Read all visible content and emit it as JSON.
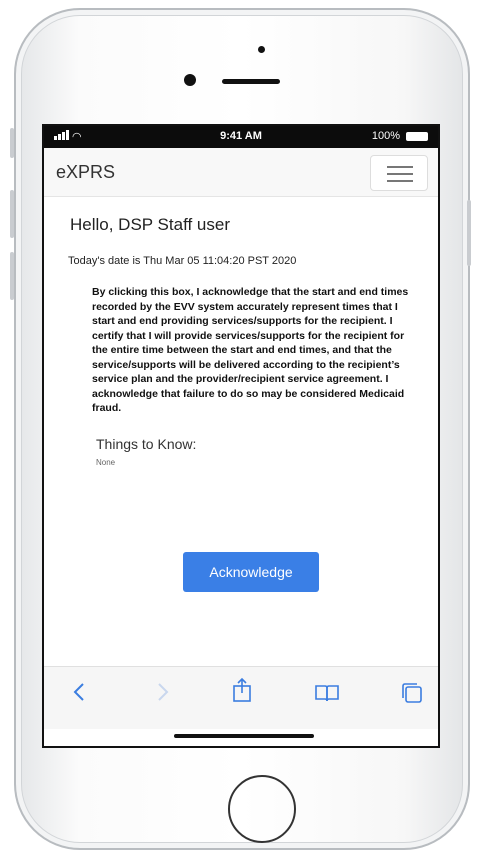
{
  "status_bar": {
    "time": "9:41 AM",
    "battery": "100%"
  },
  "navbar": {
    "brand": "eXPRS"
  },
  "main": {
    "greeting": "Hello, DSP Staff user",
    "date_line": "Today's date is Thu Mar 05 11:04:20 PST 2020",
    "acknowledgement_text": "By clicking this box, I acknowledge that the start and end times recorded by the EVV system accurately represent times that I start and end providing services/supports for the recipient. I certify that I will provide services/supports for the recipient for the entire time between the start and end times, and that the service/supports will be delivered according to the recipient’s service plan and the provider/recipient service agreement. I acknowledge that failure to do so may be considered Medicaid fraud.",
    "things_to_know_title": "Things to Know:",
    "things_to_know_body": "None",
    "acknowledge_button": "Acknowledge"
  },
  "browser_toolbar": {
    "back_icon": "chevron-left-icon",
    "forward_icon": "chevron-right-icon",
    "share_icon": "share-icon",
    "bookmarks_icon": "book-icon",
    "tabs_icon": "tabs-icon",
    "accent_color": "#3b7de0"
  }
}
